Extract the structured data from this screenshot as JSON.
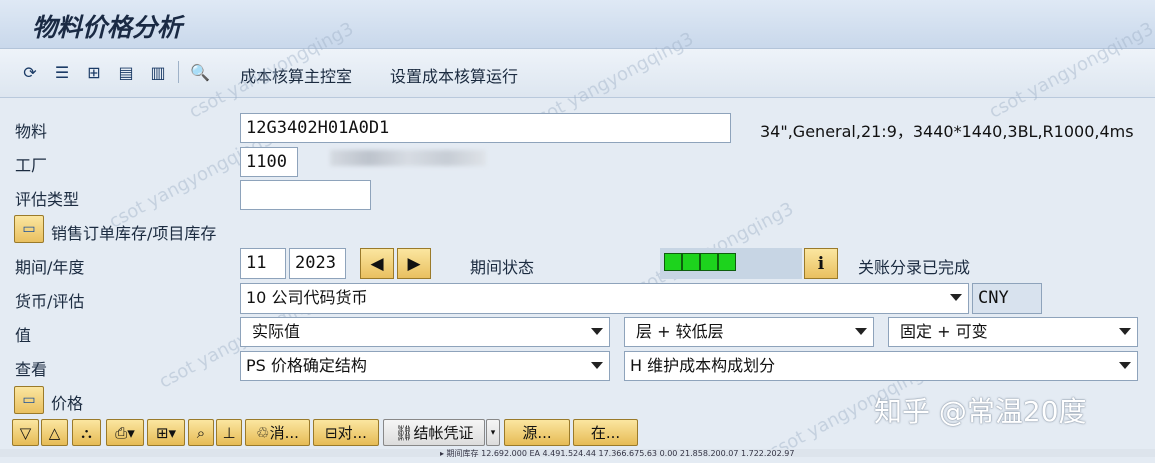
{
  "window": {
    "title": "物料价格分析"
  },
  "toolbar": {
    "icons": [
      "refresh-icon",
      "list-icon",
      "hierarchy-icon",
      "display-icon",
      "columns-icon",
      "search-icon"
    ],
    "cost_cockpit": "成本核算主控室",
    "setup_run": "设置成本核算运行"
  },
  "form": {
    "material": {
      "label": "物料",
      "value": "12G3402H01A0D1",
      "description": "34\",General,21:9，3440*1440,3BL,R1000,4ms"
    },
    "plant": {
      "label": "工厂",
      "value": "1100"
    },
    "valuation_type": {
      "label": "评估类型",
      "value": ""
    },
    "sales_order_stock": {
      "label": "销售订单库存/项目库存"
    },
    "period_year": {
      "label": "期间/年度",
      "period": "11",
      "year": "2023"
    },
    "period_status": {
      "label": "期间状态",
      "status_text": "关账分录已完成"
    },
    "currency_valuation": {
      "label": "货币/评估",
      "value": "10 公司代码货币",
      "currency": "CNY"
    },
    "value": {
      "label": "值",
      "value": "实际值",
      "layer": "层 + 较低层",
      "fixed": "固定 + 可变"
    },
    "view": {
      "label": "查看",
      "value": "PS 价格确定结构",
      "component": "H 维护成本构成划分"
    },
    "price": {
      "label": "价格"
    }
  },
  "grid_toolbar": {
    "buttons": [
      "消...",
      "对...",
      "结帐凭证",
      "源...",
      "在..."
    ]
  },
  "watermarks": {
    "user_text": "csot yangyongqing3",
    "brand": "知乎 @常温20度"
  },
  "bottom_row": "▸ 期间库存   12.692.000 EA   4.491.524.44 17.366.675.63   0.00 21.858.200.07 1.722.202.97",
  "colors": {
    "led": "#1dd31d",
    "button": "#e9c060",
    "header_bg": "#c9d8eb"
  }
}
